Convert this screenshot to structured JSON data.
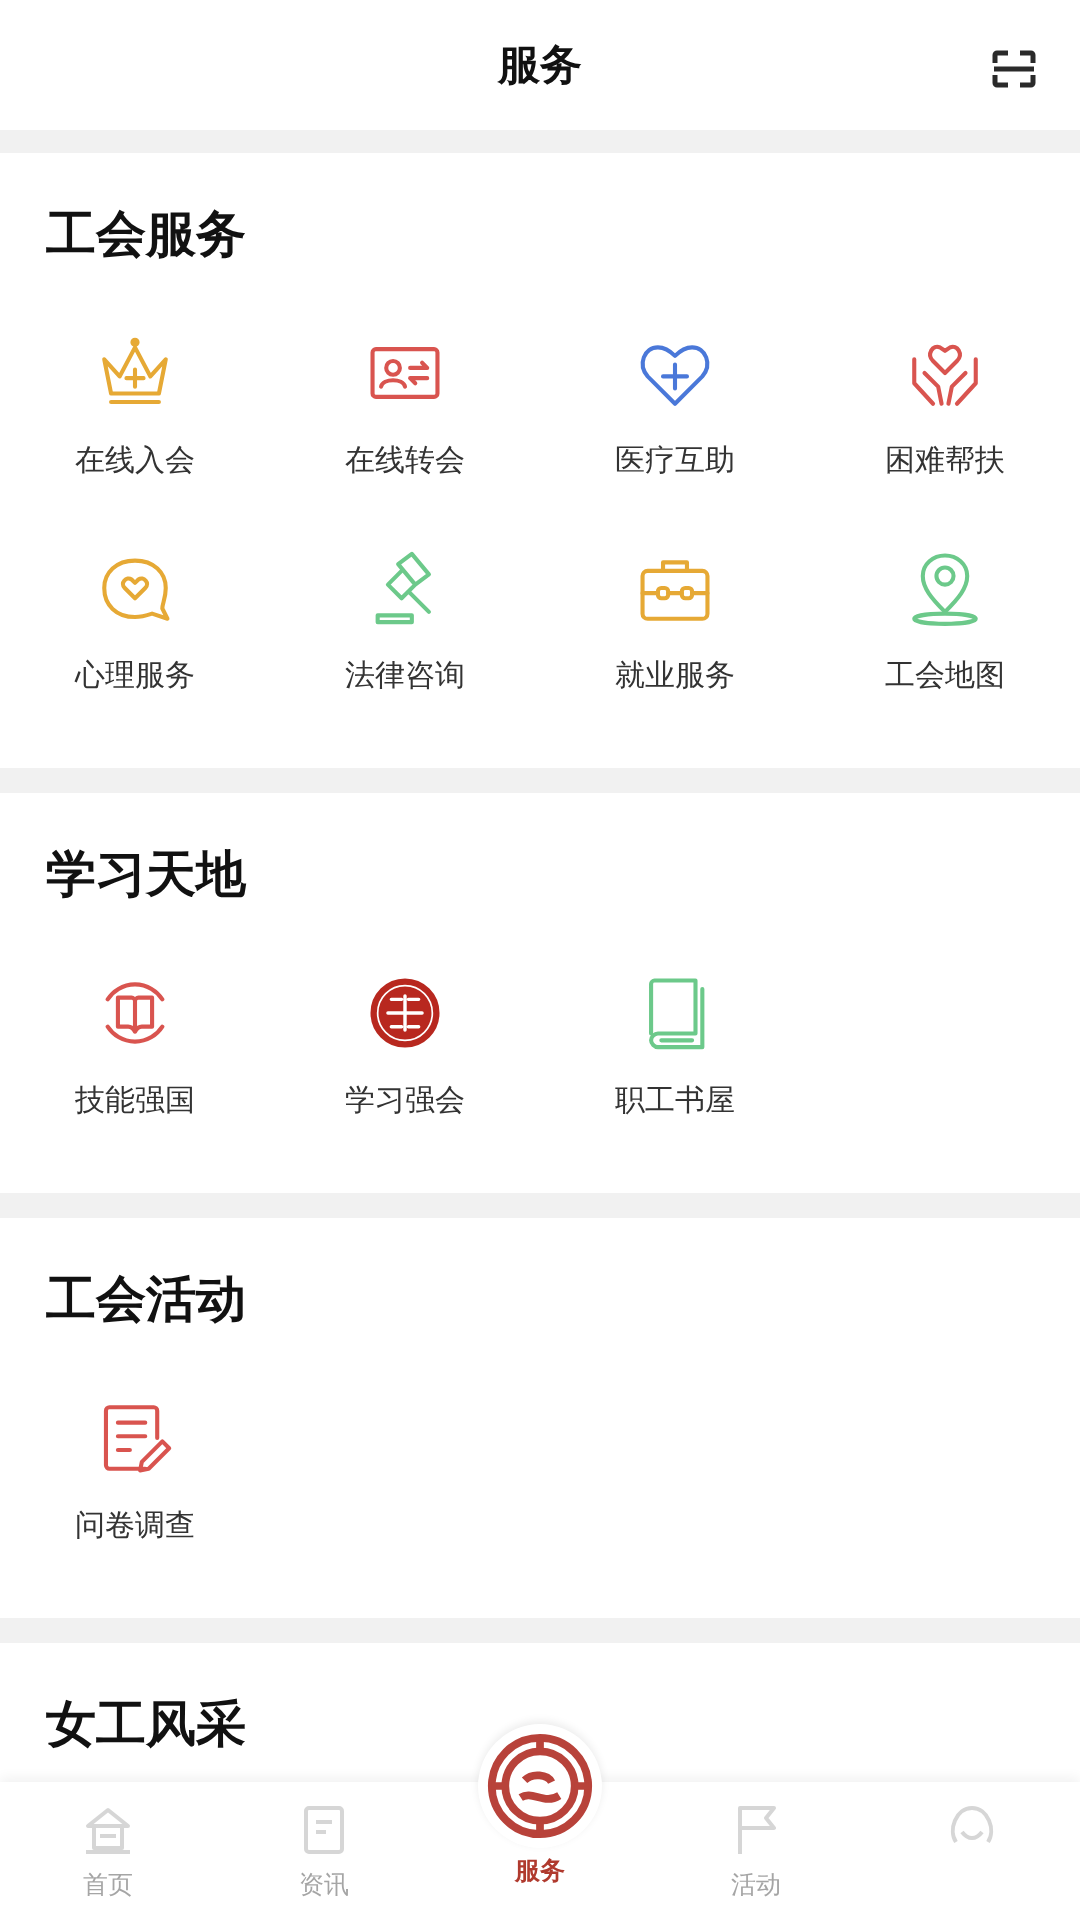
{
  "header": {
    "title": "服务"
  },
  "sections": [
    {
      "title": "工会服务",
      "items": [
        {
          "label": "在线入会",
          "color": "#e6a935"
        },
        {
          "label": "在线转会",
          "color": "#d9544f"
        },
        {
          "label": "医疗互助",
          "color": "#4a78d9"
        },
        {
          "label": "困难帮扶",
          "color": "#d9544f"
        },
        {
          "label": "心理服务",
          "color": "#e6a935"
        },
        {
          "label": "法律咨询",
          "color": "#6cc98a"
        },
        {
          "label": "就业服务",
          "color": "#e6a935"
        },
        {
          "label": "工会地图",
          "color": "#6cc98a"
        }
      ]
    },
    {
      "title": "学习天地",
      "items": [
        {
          "label": "技能强国",
          "color": "#d9544f"
        },
        {
          "label": "学习强会",
          "color": "#b8281f"
        },
        {
          "label": "职工书屋",
          "color": "#6cc98a"
        }
      ]
    },
    {
      "title": "工会活动",
      "items": [
        {
          "label": "问卷调查",
          "color": "#d9544f"
        }
      ]
    },
    {
      "title": "女工风采"
    }
  ],
  "tabbar": [
    {
      "label": "首页",
      "selected": false
    },
    {
      "label": "资讯",
      "selected": false
    },
    {
      "label": "服务",
      "selected": true
    },
    {
      "label": "活动",
      "selected": false
    },
    {
      "selected": false
    }
  ]
}
